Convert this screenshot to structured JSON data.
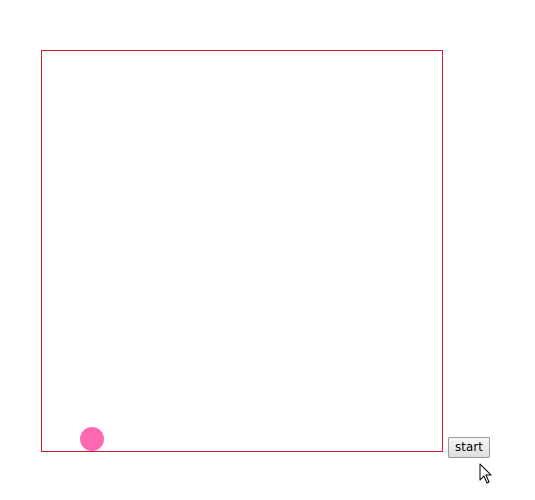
{
  "controls": {
    "start_label": "start"
  },
  "colors": {
    "stage_border": "#d11a2a",
    "ball": "#ff69b4"
  },
  "icons": {
    "cursor": "mouse-pointer-icon"
  }
}
